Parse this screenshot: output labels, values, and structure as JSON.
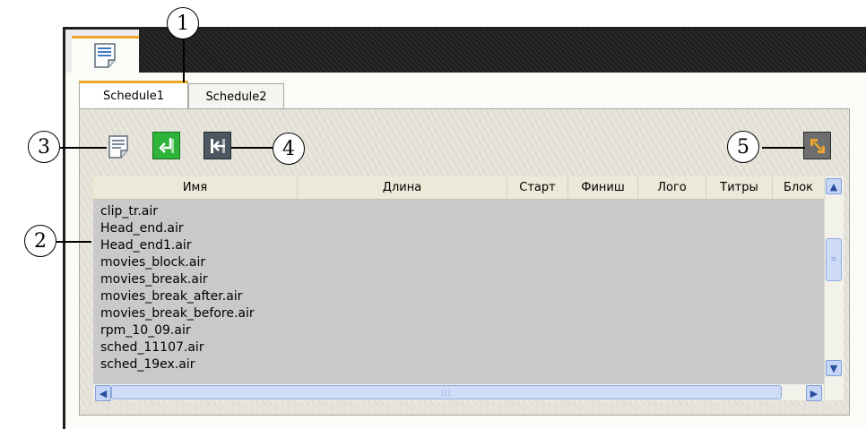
{
  "tabs": [
    {
      "label": "Schedule1",
      "active": true
    },
    {
      "label": "Schedule2",
      "active": false
    }
  ],
  "toolbar": {
    "buttons": [
      {
        "name": "new-schedule",
        "icon": "document-icon"
      },
      {
        "name": "insert",
        "icon": "insert-arrow-icon",
        "color": "#2fb43a"
      },
      {
        "name": "remove",
        "icon": "remove-arrow-icon",
        "color": "#4b5761"
      },
      {
        "name": "swap",
        "icon": "swap-arrows-icon",
        "color": "#f0a72c"
      }
    ]
  },
  "list": {
    "columns": [
      "Имя",
      "Длина",
      "Старт",
      "Финиш",
      "Лого",
      "Титры",
      "Блок"
    ],
    "items": [
      "clip_tr.air",
      "Head_end.air",
      "Head_end1.air",
      "movies_block.air",
      "movies_break.air",
      "movies_break_after.air",
      "movies_break_before.air",
      "rpm_10_09.air",
      "sched_11107.air",
      "sched_19ex.air"
    ]
  },
  "callouts": [
    "1",
    "2",
    "3",
    "4",
    "5"
  ],
  "colors": {
    "accent": "#f0a72c",
    "list_bg": "#c9c9c9"
  }
}
